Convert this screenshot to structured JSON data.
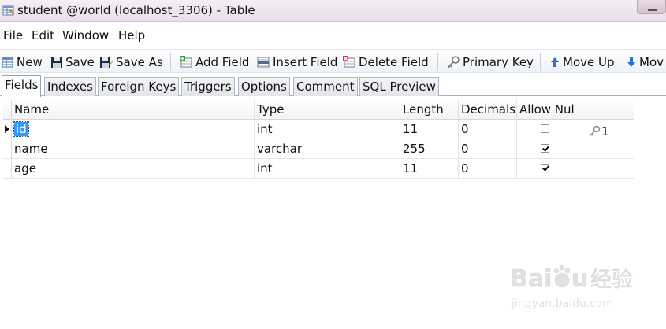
{
  "window": {
    "title": "student @world (localhost_3306) - Table"
  },
  "menu": [
    "File",
    "Edit",
    "Window",
    "Help"
  ],
  "toolbar": {
    "new": "New",
    "save": "Save",
    "save_as": "Save As",
    "add_field": "Add Field",
    "insert_field": "Insert Field",
    "delete_field": "Delete Field",
    "primary_key": "Primary Key",
    "move_up": "Move Up",
    "move_down": "Mov"
  },
  "tabs": [
    "Fields",
    "Indexes",
    "Foreign Keys",
    "Triggers",
    "Options",
    "Comment",
    "SQL Preview"
  ],
  "active_tab": "Fields",
  "grid": {
    "columns": [
      "Name",
      "Type",
      "Length",
      "Decimals",
      "Allow Nul",
      ""
    ],
    "rows": [
      {
        "name": "id",
        "type": "int",
        "length": "11",
        "decimals": "0",
        "allow_null": false,
        "key": "1",
        "selected": true
      },
      {
        "name": "name",
        "type": "varchar",
        "length": "255",
        "decimals": "0",
        "allow_null": true,
        "key": ""
      },
      {
        "name": "age",
        "type": "int",
        "length": "11",
        "decimals": "0",
        "allow_null": true,
        "key": ""
      }
    ]
  },
  "watermark": {
    "text": "Baidu经验",
    "url": "jingyan.baidu.com"
  },
  "colors": {
    "selection": "#3399ff",
    "titlebar": "#efe2ea",
    "move_arrow": "#2f6fd6"
  }
}
